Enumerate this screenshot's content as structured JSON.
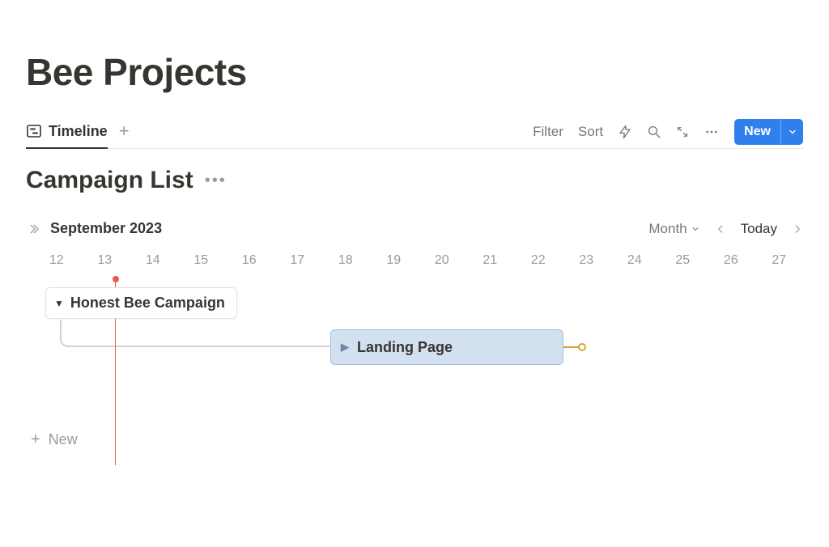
{
  "page": {
    "title": "Bee Projects"
  },
  "tabs": {
    "timeline": {
      "label": "Timeline"
    }
  },
  "toolbar": {
    "filter": "Filter",
    "sort": "Sort",
    "new": "New"
  },
  "db": {
    "title": "Campaign List"
  },
  "timeline": {
    "month_label": "September 2023",
    "scale": "Month",
    "today": "Today",
    "days": [
      "12",
      "13",
      "14",
      "15",
      "16",
      "17",
      "18",
      "19",
      "20",
      "21",
      "22",
      "23",
      "24",
      "25",
      "26",
      "27"
    ]
  },
  "group": {
    "name": "Honest Bee Campaign"
  },
  "task": {
    "name": "Landing Page"
  },
  "new_row": {
    "label": "New"
  }
}
